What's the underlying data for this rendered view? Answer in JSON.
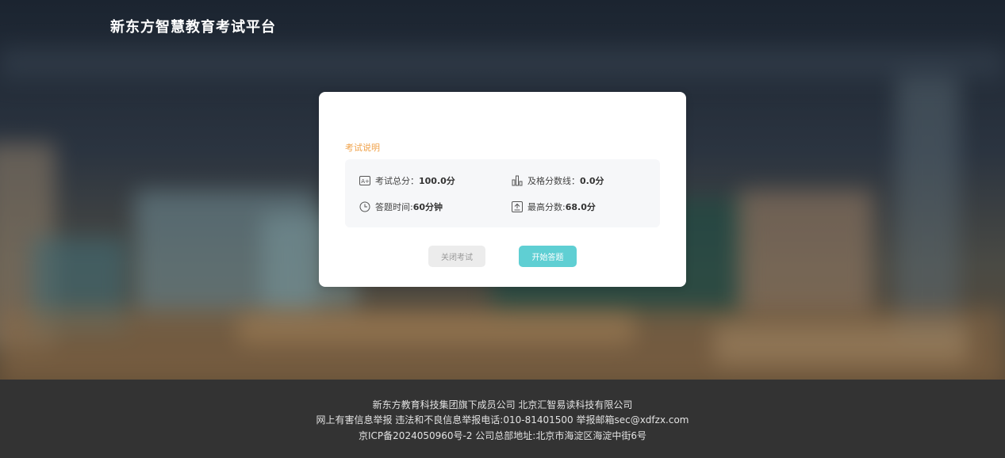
{
  "header": {
    "title": "新东方智慧教育考试平台"
  },
  "exam_card": {
    "section_title": "考试说明",
    "total_score": {
      "label": "考试总分：",
      "value": "100.0分",
      "icon": "grade-a-plus-icon"
    },
    "pass_line": {
      "label": "及格分数线：",
      "value": "0.0分",
      "icon": "bar-chart-icon"
    },
    "answer_time": {
      "label": "答题时间: ",
      "value": "60分钟",
      "icon": "clock-icon"
    },
    "highest_score": {
      "label": "最高分数:",
      "value": "68.0分",
      "icon": "upload-box-icon"
    },
    "close_button": "关闭考试",
    "start_button": "开始答题"
  },
  "footer": {
    "line1": "新东方教育科技集团旗下成员公司 北京汇智易读科技有限公司",
    "line2": "网上有害信息举报 违法和不良信息举报电话:010-81401500 举报邮箱sec@xdfzx.com",
    "line3": "京ICP备2024050960号-2 公司总部地址:北京市海淀区海淀中街6号"
  },
  "colors": {
    "accent": "#5fcfd3",
    "section_label": "#f0a24a",
    "footer_bg": "#333333"
  }
}
